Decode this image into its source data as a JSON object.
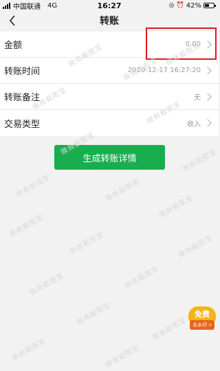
{
  "status_bar": {
    "carrier": "中国联通",
    "network": "4G",
    "time": "16:27",
    "battery": "42%"
  },
  "nav": {
    "title": "转账"
  },
  "rows": [
    {
      "label": "金额",
      "value": "0.00"
    },
    {
      "label": "转账时间",
      "value": "2020-12-17 16:27:20"
    },
    {
      "label": "转账备注",
      "value": "无"
    },
    {
      "label": "交易类型",
      "value": "收入"
    }
  ],
  "button": {
    "label": "生成转账详情"
  },
  "watermark": {
    "text": "微商截图宝"
  },
  "badge": {
    "top": "免费",
    "bottom": "去水印 »"
  },
  "colors": {
    "primary": "#1aad4f",
    "highlight": "#e0151d"
  }
}
